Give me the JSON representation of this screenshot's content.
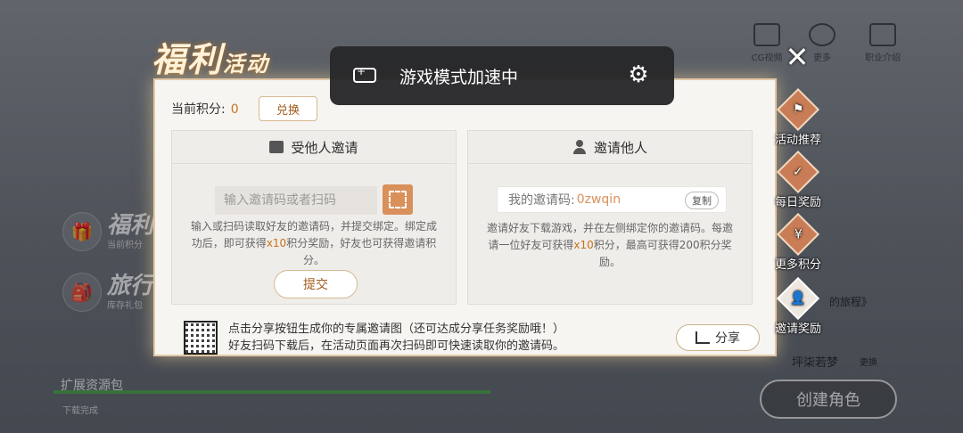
{
  "background": {
    "top_icons": [
      "CG视频",
      "更多",
      "职业介绍"
    ],
    "left_items": [
      {
        "big": "福利",
        "small": "当前积分"
      },
      {
        "big": "旅行",
        "small": "库存礼包"
      }
    ],
    "expand_pack": "扩展资源包",
    "download_done": "下载完成",
    "journey_text": "的旅程》",
    "suggest_name": "坪柒若梦",
    "change_label": "更换",
    "create_role": "创建角色"
  },
  "panel": {
    "title_main": "福利",
    "title_sub": "活动",
    "points_label": "当前积分:",
    "points_value": "0",
    "exchange_label": "兑换",
    "left_card": {
      "title": "受他人邀请",
      "input_placeholder": "输入邀请码或者扫码",
      "desc_part1": "输入或扫码读取好友的邀请码，并提交绑定。绑定成功后，即可获得",
      "desc_highlight": "x10",
      "desc_part2": "积分奖励，好友也可获得邀请积分。",
      "submit_label": "提交"
    },
    "right_card": {
      "title": "邀请他人",
      "code_label": "我的邀请码:",
      "code_value": "0zwqin",
      "copy_label": "复制",
      "desc_part1": "邀请好友下载游戏，并在左侧绑定你的邀请码。每邀请一位好友可获得",
      "desc_highlight1": "x",
      "desc_highlight2": "10",
      "desc_part2": "积分，最高可获得200积分奖励。"
    },
    "share_line1": "点击分享按钮生成你的专属邀请图（还可达成分享任务奖励哦！）",
    "share_line2": "好友扫码下载后，在活动页面再次扫码即可快速读取你的邀请码。",
    "share_label": "分享"
  },
  "toast": {
    "text": "游戏模式加速中"
  },
  "nav": {
    "items": [
      {
        "label": "活动推荐",
        "icon": "flag-icon",
        "glyph": "⚑"
      },
      {
        "label": "每日奖励",
        "icon": "calendar-check-icon",
        "glyph": "✓"
      },
      {
        "label": "更多积分",
        "icon": "money-bag-icon",
        "glyph": "¥"
      },
      {
        "label": "邀请奖励",
        "icon": "invite-user-icon",
        "glyph": "👤"
      }
    ],
    "active_index": 3
  },
  "colors": {
    "accent": "#c8721c",
    "nav_diamond": "#c97d56",
    "toast_bg": "#28282a"
  }
}
